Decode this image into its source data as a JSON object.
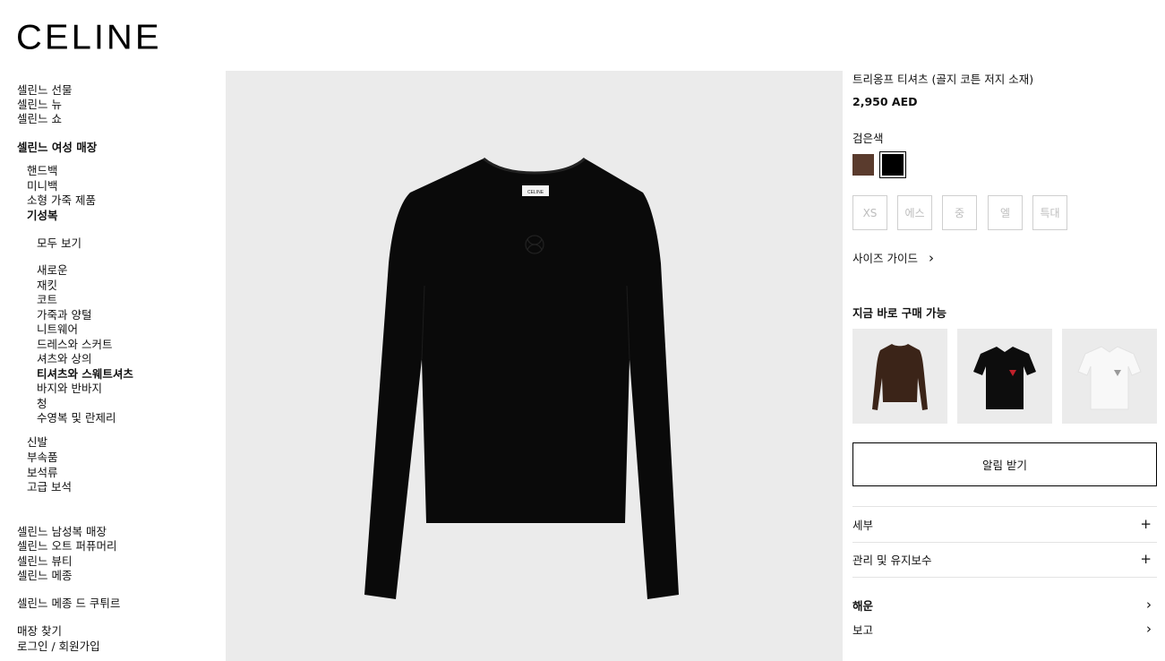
{
  "brand": {
    "logo": "CELINE"
  },
  "nav": {
    "top_links": [
      "셀린느 선물",
      "셀린느 뉴",
      "셀린느 쇼"
    ],
    "women_store": "셀린느 여성 매장",
    "women_categories": [
      "핸드백",
      "미니백",
      "소형 가죽 제품",
      "기성복"
    ],
    "view_all": "모두 보기",
    "rtw_items": [
      "새로운",
      "재킷",
      "코트",
      "가죽과 양털",
      "니트웨어",
      "드레스와 스커트",
      "셔츠와 상의",
      "티셔츠와 스웨트셔츠",
      "바지와 반바지",
      "청",
      "수영복 및 란제리"
    ],
    "more_categories": [
      "신발",
      "부속품",
      "보석류",
      "고급 보석"
    ],
    "other_stores": [
      "셀린느 남성복 매장",
      "셀린느 오트 퍼퓨머리",
      "셀린느 뷰티",
      "셀린느 메종"
    ],
    "couture": "셀린느 메종 드 쿠튀르",
    "store_locator": "매장 찾기",
    "login": "로그인 / 회원가입"
  },
  "product": {
    "title": "트리옹프 티셔츠 (골지 코튼 저지 소재)",
    "price": "2,950 AED",
    "color_label": "검은색",
    "colors": [
      "#5a3b2d",
      "#000000"
    ],
    "sizes": [
      "XS",
      "에스",
      "중",
      "엘",
      "특대"
    ],
    "size_guide": "사이즈 가이드",
    "tag_text": "CELINE"
  },
  "available_now": {
    "title": "지금 바로 구매 가능",
    "items": [
      {
        "icon": "brown-long-sleeve-tshirt"
      },
      {
        "icon": "black-polo-shirt"
      },
      {
        "icon": "white-polo-shirt"
      }
    ]
  },
  "actions": {
    "notify": "알림 받기"
  },
  "accordions": {
    "details": "세부",
    "care": "관리 및 유지보수",
    "shipping": "해운",
    "view": "보고",
    "plus": "+",
    "chevron": "›"
  }
}
